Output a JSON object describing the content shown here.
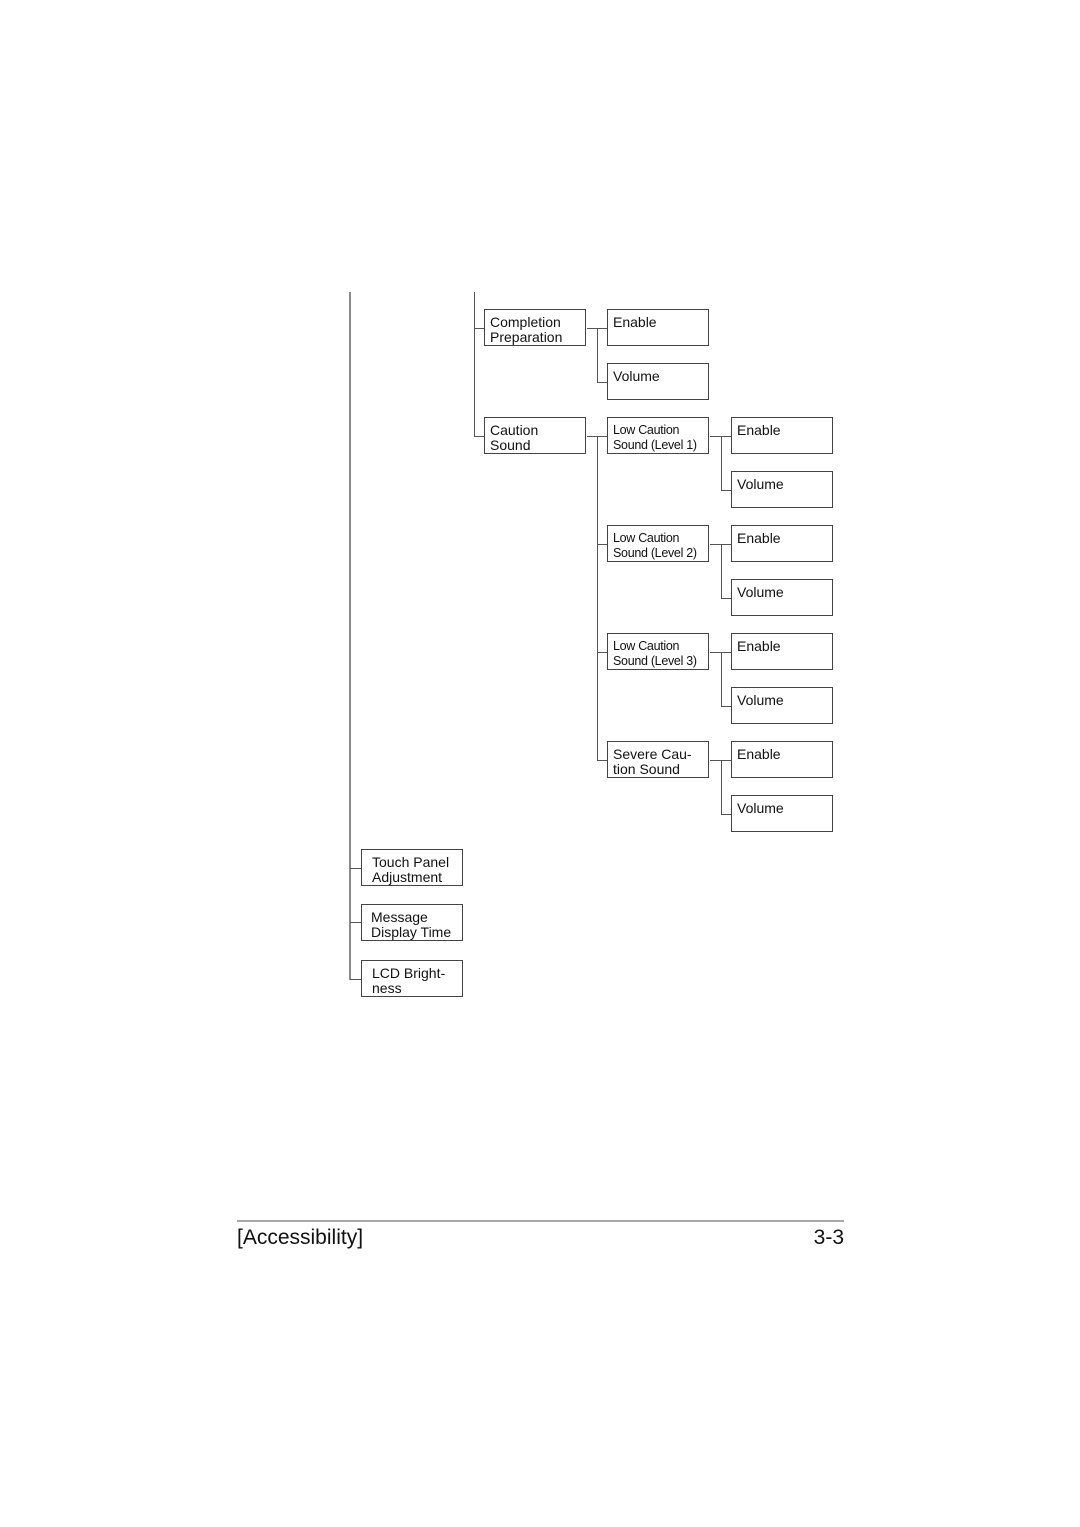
{
  "tree": {
    "completion_preparation": {
      "label": "Completion\nPreparation",
      "children": [
        "Enable",
        "Volume"
      ]
    },
    "caution_sound": {
      "label": "Caution\nSound",
      "children": [
        {
          "label": "Low Caution\nSound (Level 1)",
          "children": [
            "Enable",
            "Volume"
          ]
        },
        {
          "label": "Low Caution\nSound (Level 2)",
          "children": [
            "Enable",
            "Volume"
          ]
        },
        {
          "label": "Low Caution\nSound (Level 3)",
          "children": [
            "Enable",
            "Volume"
          ]
        },
        {
          "label": "Severe Cau-\ntion Sound",
          "children": [
            "Enable",
            "Volume"
          ]
        }
      ]
    },
    "top_level_items": [
      {
        "label": "Touch Panel\nAdjustment"
      },
      {
        "label": "Message\nDisplay Time"
      },
      {
        "label": "LCD Bright-\nness"
      }
    ]
  },
  "footer": {
    "section": "[Accessibility]",
    "page_number": "3-3"
  }
}
